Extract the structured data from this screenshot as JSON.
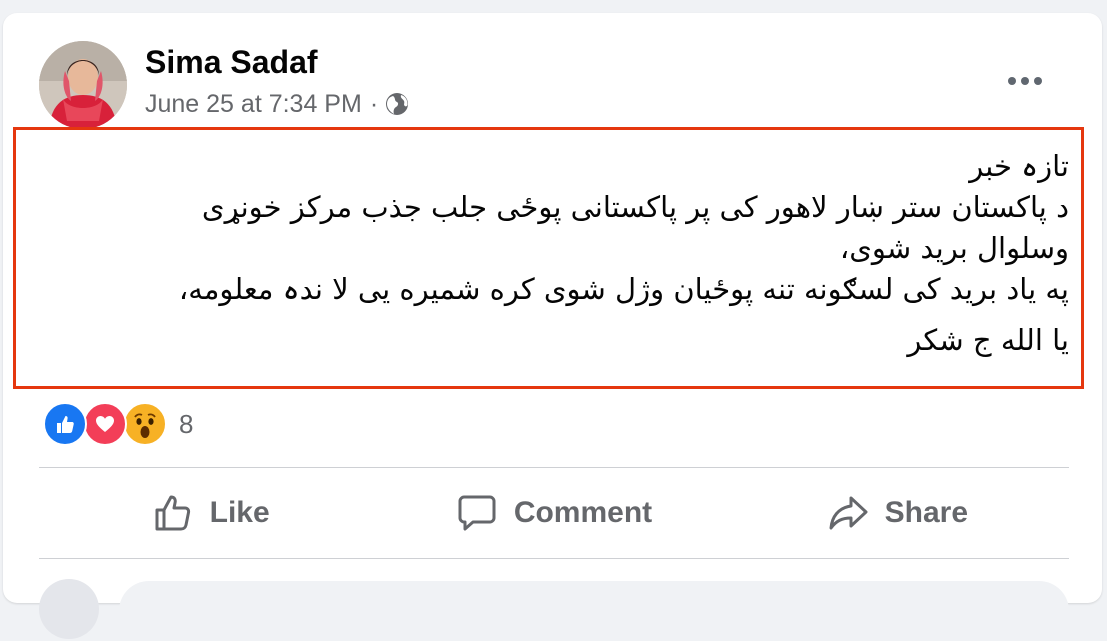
{
  "post": {
    "author": "Sima Sadaf",
    "timestamp": "June 25 at 7:34 PM",
    "separator": "·",
    "privacy_icon": "globe-icon",
    "more_icon": "more-options-icon",
    "text_lines": [
      "تازہ خبر",
      "د پاکستان ستر ښار لاهور کی پر پاکستانی پوځی جلب جذب مرکز خونړی",
      "وسلوال برید شوی،",
      "په یاد برید کی لسګونه تنه پوځیان وژل شوی کره شمیره یی لا ندہ معلومه،",
      "یا الله ج شکر"
    ],
    "highlight_color": "#e5370f"
  },
  "reactions": {
    "icons": [
      "like-reaction-icon",
      "love-reaction-icon",
      "wow-reaction-icon"
    ],
    "count": "8"
  },
  "actions": {
    "like_label": "Like",
    "comment_label": "Comment",
    "share_label": "Share"
  },
  "colors": {
    "like_blue": "#1877f2",
    "love_red": "#f33e58",
    "wow_yellow": "#f7b125",
    "secondary_text": "#65676b"
  }
}
